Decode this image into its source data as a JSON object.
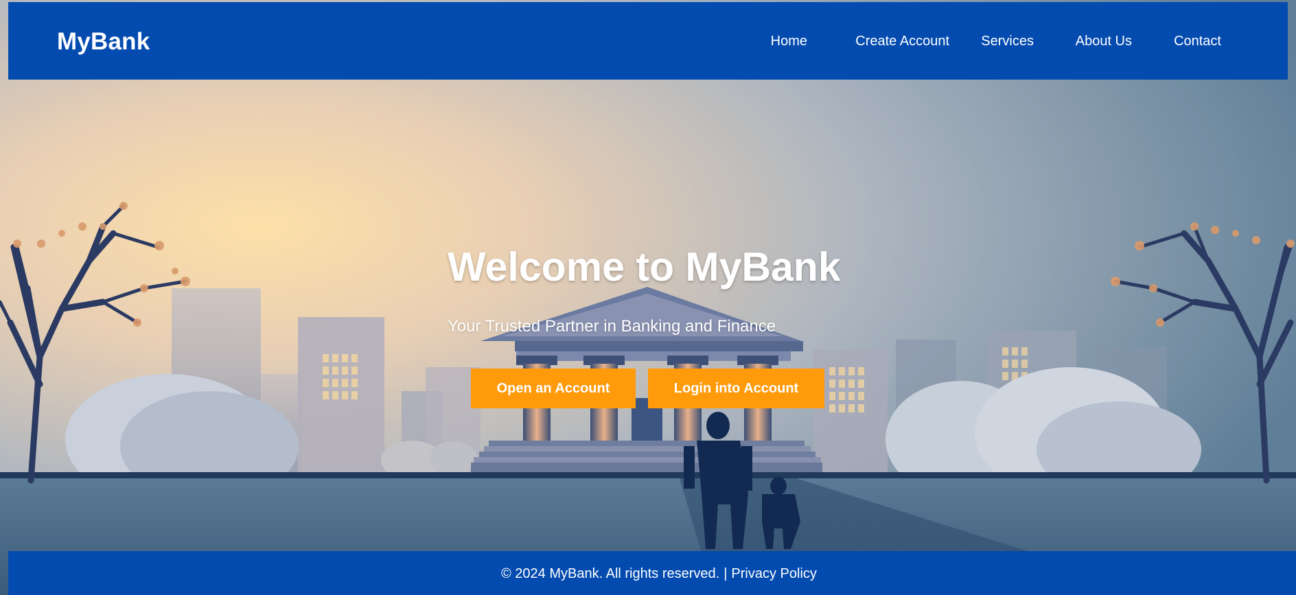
{
  "header": {
    "logo": "MyBank",
    "nav": [
      {
        "label": "Home"
      },
      {
        "label": "Create Account"
      },
      {
        "label": "Services"
      },
      {
        "label": "About Us"
      },
      {
        "label": "Contact"
      }
    ]
  },
  "hero": {
    "title": "Welcome to MyBank",
    "subtitle": "Your Trusted Partner in Banking and Finance",
    "open_button": "Open an Account",
    "login_button": "Login into Account"
  },
  "footer": {
    "copyright": "© 2024 MyBank. All rights reserved.",
    "separator": "|",
    "privacy_link": "Privacy Policy"
  },
  "colors": {
    "brand": "#034baf",
    "accent": "#ff9a0a",
    "text": "#ffffff"
  }
}
